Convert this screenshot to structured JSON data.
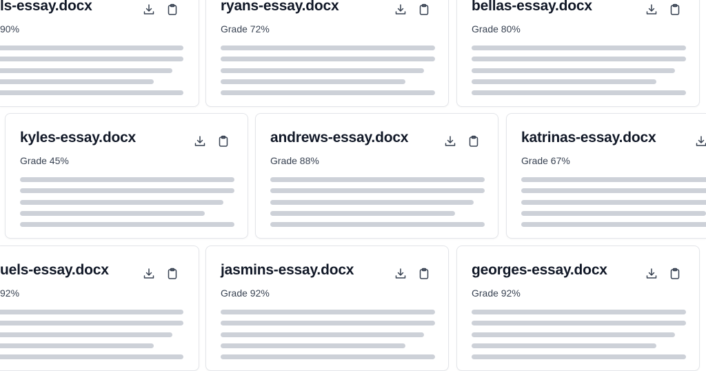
{
  "cards": [
    {
      "title": "ls-essay.docx",
      "grade": "90%"
    },
    {
      "title": "ryans-essay.docx",
      "grade": "Grade 72%"
    },
    {
      "title": "bellas-essay.docx",
      "grade": "Grade 80%"
    },
    {
      "title": "kyles-essay.docx",
      "grade": "Grade 45%"
    },
    {
      "title": "andrews-essay.docx",
      "grade": "Grade 88%"
    },
    {
      "title": "katrinas-essay.docx",
      "grade": "Grade 67%"
    },
    {
      "title": "uels-essay.docx",
      "grade": "92%"
    },
    {
      "title": "jasmins-essay.docx",
      "grade": "Grade 92%"
    },
    {
      "title": "georges-essay.docx",
      "grade": "Grade 92%"
    }
  ],
  "icons": {
    "download": "download-icon",
    "copy": "clipboard-icon"
  }
}
